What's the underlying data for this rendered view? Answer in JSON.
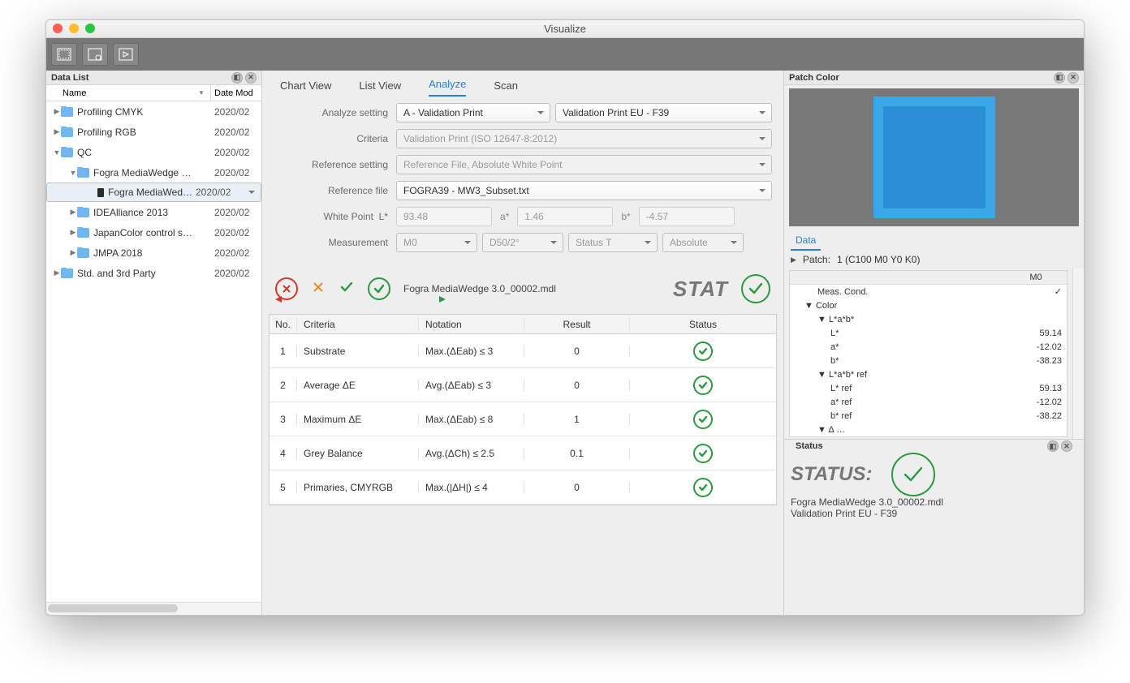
{
  "window": {
    "title": "Visualize"
  },
  "left_panel": {
    "title": "Data List",
    "columns": {
      "name": "Name",
      "date": "Date Mod"
    },
    "tree": [
      {
        "icon": "folder",
        "label": "Profiling CMYK",
        "date": "2020/02",
        "level": 0,
        "expander": "right"
      },
      {
        "icon": "folder",
        "label": "Profiling RGB",
        "date": "2020/02",
        "level": 0,
        "expander": "right"
      },
      {
        "icon": "folder",
        "label": "QC",
        "date": "2020/02",
        "level": 0,
        "expander": "down"
      },
      {
        "icon": "folder",
        "label": "Fogra MediaWedge …",
        "date": "2020/02",
        "level": 1,
        "expander": "down"
      },
      {
        "icon": "file",
        "label": "Fogra MediaWed…",
        "date": "2020/02",
        "level": 2,
        "expander": "",
        "selected": true
      },
      {
        "icon": "folder",
        "label": "IDEAlliance 2013",
        "date": "2020/02",
        "level": 1,
        "expander": "right"
      },
      {
        "icon": "folder",
        "label": "JapanColor control s…",
        "date": "2020/02",
        "level": 1,
        "expander": "right"
      },
      {
        "icon": "folder",
        "label": "JMPA 2018",
        "date": "2020/02",
        "level": 1,
        "expander": "right"
      },
      {
        "icon": "folder",
        "label": "Std. and 3rd Party",
        "date": "2020/02",
        "level": 0,
        "expander": "right"
      }
    ]
  },
  "center": {
    "tabs": [
      "Chart View",
      "List View",
      "Analyze",
      "Scan"
    ],
    "active_tab": "Analyze",
    "labels": {
      "analyze_setting": "Analyze setting",
      "criteria": "Criteria",
      "reference_setting": "Reference setting",
      "reference_file": "Reference file",
      "white_point": "White Point",
      "measurement": "Measurement"
    },
    "analyze_setting_a": "A - Validation Print",
    "analyze_setting_b": "Validation Print EU - F39",
    "criteria": "Validation Print (ISO 12647-8:2012)",
    "reference_setting": "Reference File, Absolute White Point",
    "reference_file": "FOGRA39 - MW3_Subset.txt",
    "white_point": {
      "L_label": "L*",
      "L": "93.48",
      "a_label": "a*",
      "a": "1.46",
      "b_label": "b*",
      "b": "-4.57"
    },
    "measurement": {
      "m": "M0",
      "ill": "D50/2°",
      "status": "Status T",
      "abs": "Absolute"
    },
    "filename": "Fogra MediaWedge 3.0_00002.mdl",
    "stat_label": "STAT",
    "grid_headers": {
      "no": "No.",
      "criteria": "Criteria",
      "notation": "Notation",
      "result": "Result",
      "status": "Status"
    },
    "grid": [
      {
        "no": "1",
        "criteria": "Substrate",
        "notation": "Max.(ΔEab)   ≤ 3",
        "result": "0"
      },
      {
        "no": "2",
        "criteria": "Average ΔE",
        "notation": "Avg.(ΔEab)   ≤ 3",
        "result": "0"
      },
      {
        "no": "3",
        "criteria": "Maximum ΔE",
        "notation": "Max.(ΔEab)   ≤ 8",
        "result": "1"
      },
      {
        "no": "4",
        "criteria": "Grey Balance",
        "notation": "Avg.(ΔCh)   ≤ 2.5",
        "result": "0.1"
      },
      {
        "no": "5",
        "criteria": "Primaries, CMYRGB",
        "notation": "Max.(|ΔH|)   ≤ 4",
        "result": "0"
      }
    ]
  },
  "right": {
    "title": "Patch Color",
    "data_tab": "Data",
    "patch_label": "Patch:",
    "patch_value": "1 (C100 M0 Y0 K0)",
    "col_header": "M0",
    "rows": [
      {
        "k": "Meas. Cond.",
        "v": "✓",
        "lvl": 1
      },
      {
        "k": "Color",
        "v": "",
        "lvl": 0,
        "tri": "down"
      },
      {
        "k": "L*a*b*",
        "v": "",
        "lvl": 1,
        "tri": "down"
      },
      {
        "k": "L*",
        "v": "59.14",
        "lvl": 2
      },
      {
        "k": "a*",
        "v": "-12.02",
        "lvl": 2
      },
      {
        "k": "b*",
        "v": "-38.23",
        "lvl": 2
      },
      {
        "k": "L*a*b* ref",
        "v": "",
        "lvl": 1,
        "tri": "down"
      },
      {
        "k": "L* ref",
        "v": "59.13",
        "lvl": 2
      },
      {
        "k": "a* ref",
        "v": "-12.02",
        "lvl": 2
      },
      {
        "k": "b* ref",
        "v": "-38.22",
        "lvl": 2
      },
      {
        "k": "Δ …",
        "v": "",
        "lvl": 1,
        "tri": "down"
      }
    ],
    "status_panel_title": "Status",
    "status_label": "STATUS:",
    "status_file": "Fogra MediaWedge 3.0_00002.mdl",
    "status_profile": "Validation Print EU - F39"
  }
}
